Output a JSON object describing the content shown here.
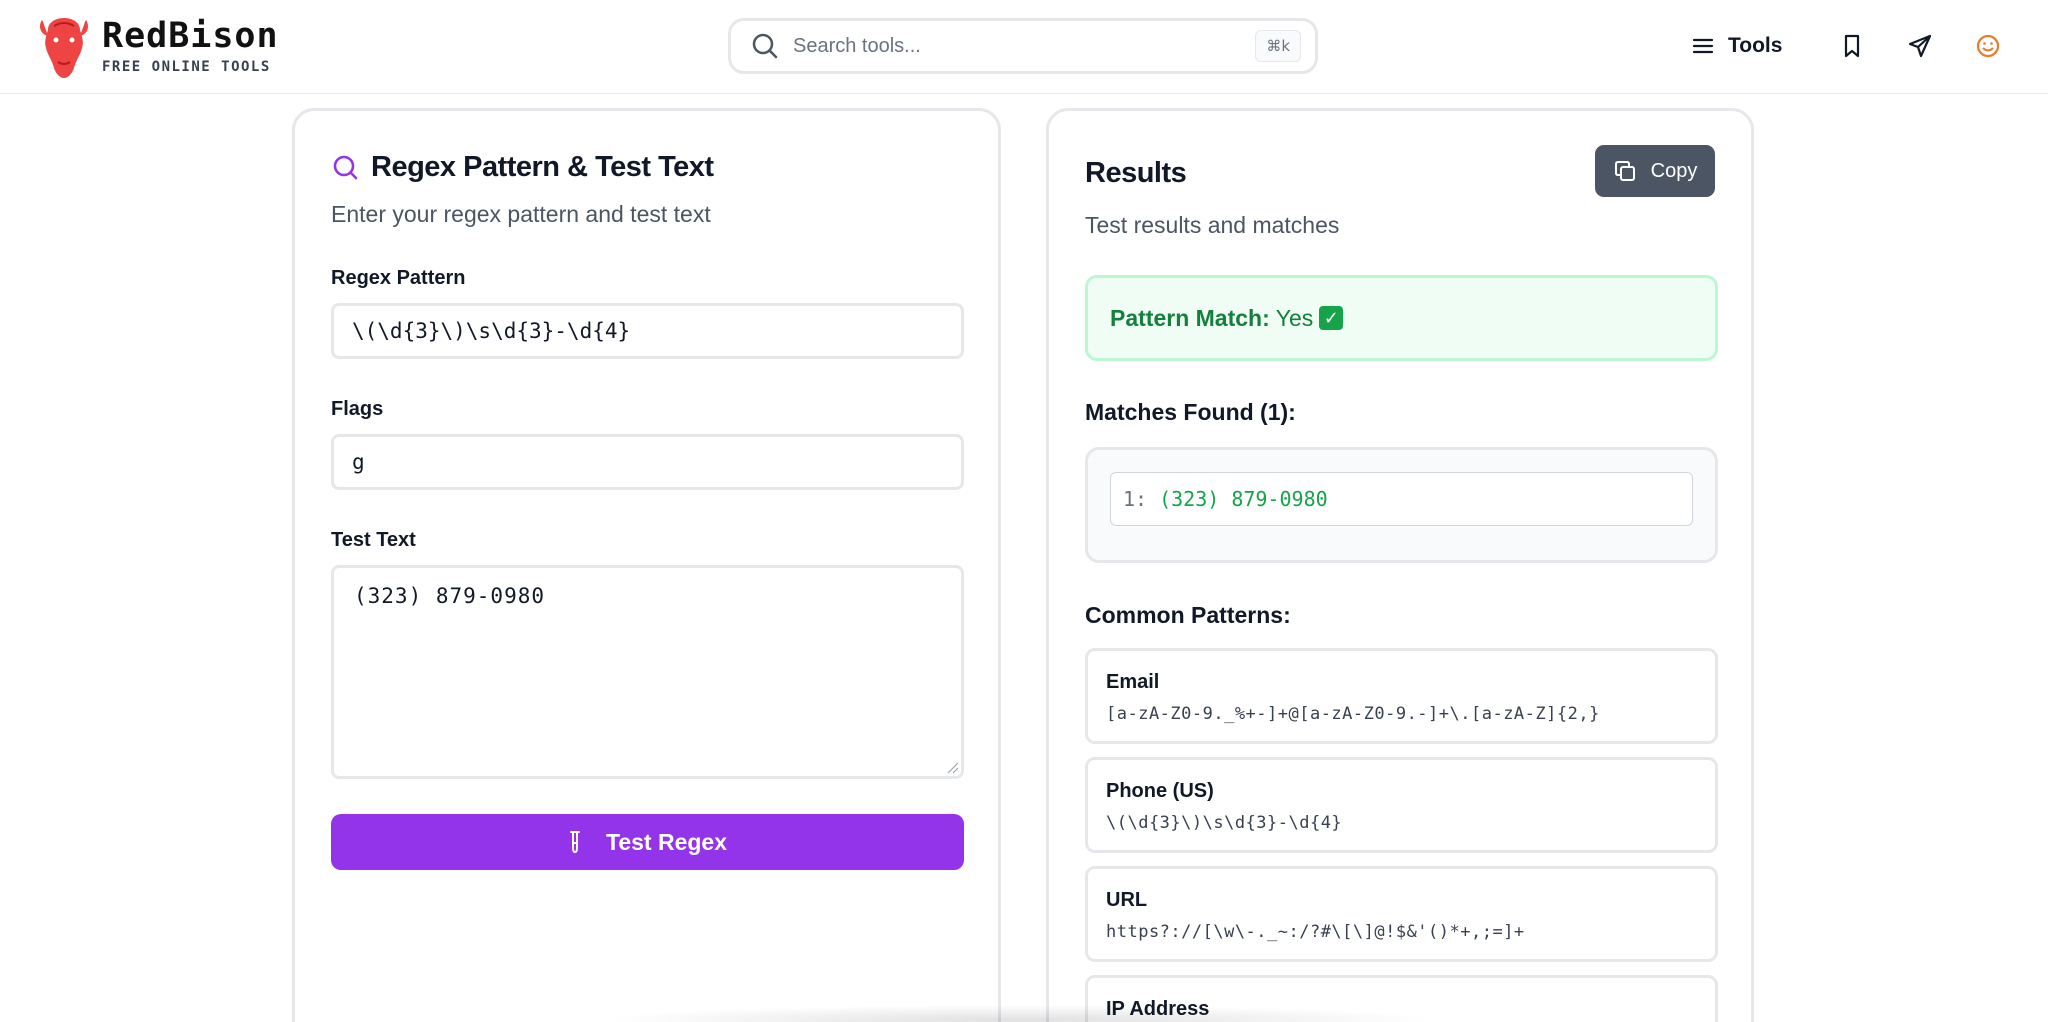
{
  "header": {
    "brand_title": "RedBison",
    "brand_subtitle": "FREE ONLINE TOOLS",
    "search_placeholder": "Search tools...",
    "search_shortcut": "⌘k",
    "tools_label": "Tools",
    "icons": [
      "menu-icon",
      "bookmark-icon",
      "send-icon",
      "smile-icon"
    ]
  },
  "left": {
    "title": "Regex Pattern & Test Text",
    "subtitle": "Enter your regex pattern and test text",
    "pattern_label": "Regex Pattern",
    "pattern_value": "\\(\\d{3}\\)\\s\\d{3}-\\d{4}",
    "flags_label": "Flags",
    "flags_value": "g",
    "test_text_label": "Test Text",
    "test_text_value": "(323) 879-0980",
    "test_button": "Test Regex"
  },
  "right": {
    "title": "Results",
    "subtitle": "Test results and matches",
    "copy_button": "Copy",
    "match_label": "Pattern Match:",
    "match_value": "Yes",
    "match_emoji": "✓",
    "matches_heading": "Matches Found (1):",
    "matches": [
      {
        "index": "1:",
        "text": "(323) 879-0980"
      }
    ],
    "common_heading": "Common Patterns:",
    "patterns": [
      {
        "name": "Email",
        "regex": "[a-zA-Z0-9._%+-]+@[a-zA-Z0-9.-]+\\.[a-zA-Z]{2,}"
      },
      {
        "name": "Phone (US)",
        "regex": "\\(\\d{3}\\)\\s\\d{3}-\\d{4}"
      },
      {
        "name": "URL",
        "regex": "https?://[\\w\\-._~:/?#\\[\\]@!$&'()*+,;=]+"
      },
      {
        "name": "IP Address",
        "regex": ""
      }
    ]
  },
  "colors": {
    "accent_purple": "#9333ea",
    "brand_red": "#ef4444",
    "success_green": "#15803d",
    "copy_button_bg": "#4b5563"
  }
}
